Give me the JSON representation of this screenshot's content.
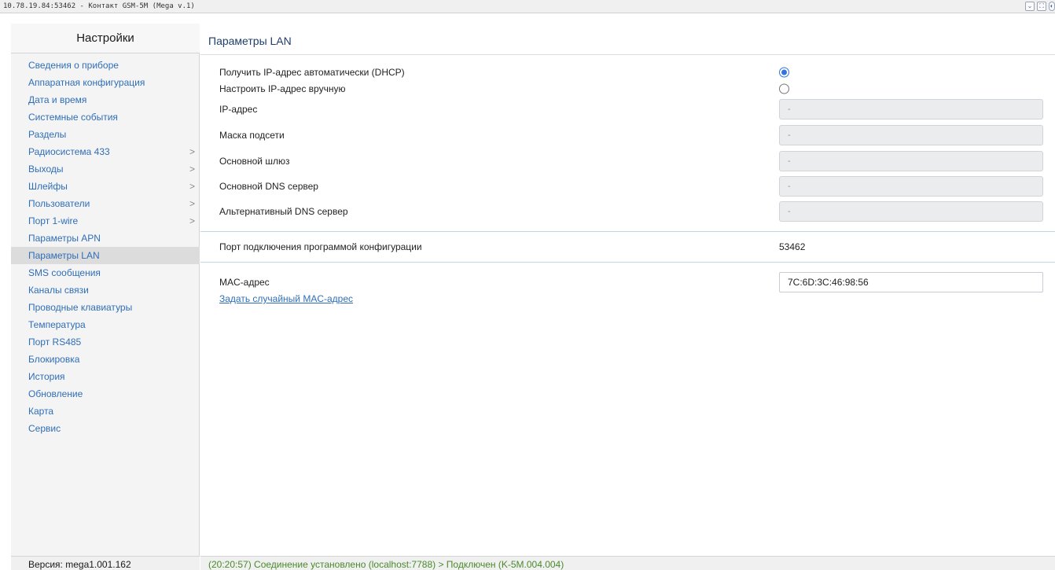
{
  "window": {
    "title": "10.78.19.84:53462 - Контакт GSM-5M (Mega v.1)",
    "controls": [
      "⌄",
      "⛶",
      "◐"
    ]
  },
  "sidebar": {
    "title": "Настройки",
    "items": [
      {
        "label": "Сведения о приборе",
        "chevron": ""
      },
      {
        "label": "Аппаратная конфигурация",
        "chevron": ""
      },
      {
        "label": "Дата и время",
        "chevron": ""
      },
      {
        "label": "Системные события",
        "chevron": ""
      },
      {
        "label": "Разделы",
        "chevron": ""
      },
      {
        "label": "Радиосистема 433",
        "chevron": ">"
      },
      {
        "label": "Выходы",
        "chevron": ">"
      },
      {
        "label": "Шлейфы",
        "chevron": ">"
      },
      {
        "label": "Пользователи",
        "chevron": ">"
      },
      {
        "label": "Порт 1-wire",
        "chevron": ">"
      },
      {
        "label": "Параметры APN",
        "chevron": ""
      },
      {
        "label": "Параметры LAN",
        "chevron": ""
      },
      {
        "label": "SMS сообщения",
        "chevron": ""
      },
      {
        "label": "Каналы связи",
        "chevron": ""
      },
      {
        "label": "Проводные клавиатуры",
        "chevron": ""
      },
      {
        "label": "Температура",
        "chevron": ""
      },
      {
        "label": "Порт RS485",
        "chevron": ""
      },
      {
        "label": "Блокировка",
        "chevron": ""
      },
      {
        "label": "История",
        "chevron": ""
      },
      {
        "label": "Обновление",
        "chevron": ""
      },
      {
        "label": "Карта",
        "chevron": ""
      },
      {
        "label": "Сервис",
        "chevron": ""
      }
    ],
    "version": "Версия: mega1.001.162"
  },
  "main": {
    "title": "Параметры LAN",
    "dhcp_label": "Получить IP-адрес автоматически (DHCP)",
    "manual_label": "Настроить IP-адрес вручную",
    "ip_label": "IP-адрес",
    "ip_value": "-",
    "mask_label": "Маска подсети",
    "mask_value": "-",
    "gateway_label": "Основной шлюз",
    "gateway_value": "-",
    "dns1_label": "Основной DNS сервер",
    "dns1_value": "-",
    "dns2_label": "Альтернативный DNS сервер",
    "dns2_value": "-",
    "port_label": "Порт подключения программой конфигурации",
    "port_value": "53462",
    "mac_label": "MAC-адрес",
    "mac_value": "7C:6D:3C:46:98:56",
    "random_mac_link": "Задать случайный MAC-адрес"
  },
  "status": {
    "text": "(20:20:57) Соединение установлено (localhost:7788) > Подключен (K-5M.004.004)"
  },
  "colors": {
    "link": "#2f6eb8",
    "title": "#1f3e69",
    "status": "#4a8a2a",
    "radio_accent": "#2f73e0"
  }
}
